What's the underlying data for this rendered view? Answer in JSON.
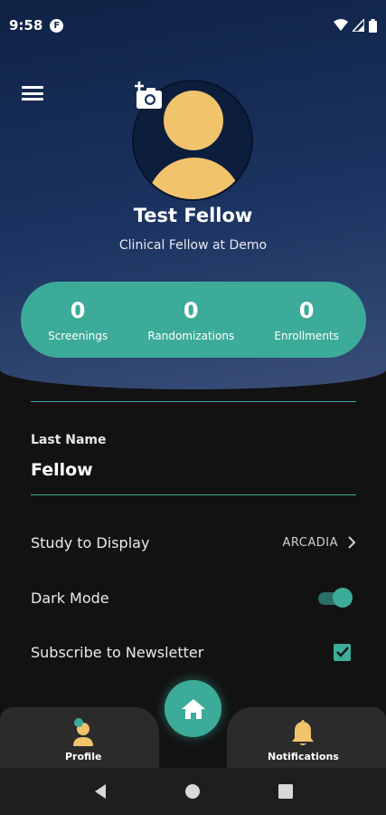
{
  "status_bar": {
    "time": "9:58",
    "app_icon_glyph": "F"
  },
  "header": {
    "menu_icon": "hamburger-menu-icon",
    "camera_icon": "add-photo-icon"
  },
  "profile": {
    "name": "Test Fellow",
    "role": "Clinical Fellow at Demo",
    "avatar_color": "#f1c36b"
  },
  "stats": [
    {
      "value": "0",
      "label": "Screenings"
    },
    {
      "value": "0",
      "label": "Randomizations"
    },
    {
      "value": "0",
      "label": "Enrollments"
    }
  ],
  "fields": {
    "last_name_label": "Last Name",
    "last_name_value": "Fellow"
  },
  "settings": {
    "study_label": "Study to Display",
    "study_value": "ARCADIA",
    "dark_mode_label": "Dark Mode",
    "dark_mode_on": true,
    "newsletter_label": "Subscribe to Newsletter",
    "newsletter_checked": true
  },
  "bottom_nav": {
    "profile_label": "Profile",
    "notifications_label": "Notifications"
  },
  "colors": {
    "accent": "#3dab99",
    "header_dark": "#0f2245",
    "background": "#121212"
  }
}
